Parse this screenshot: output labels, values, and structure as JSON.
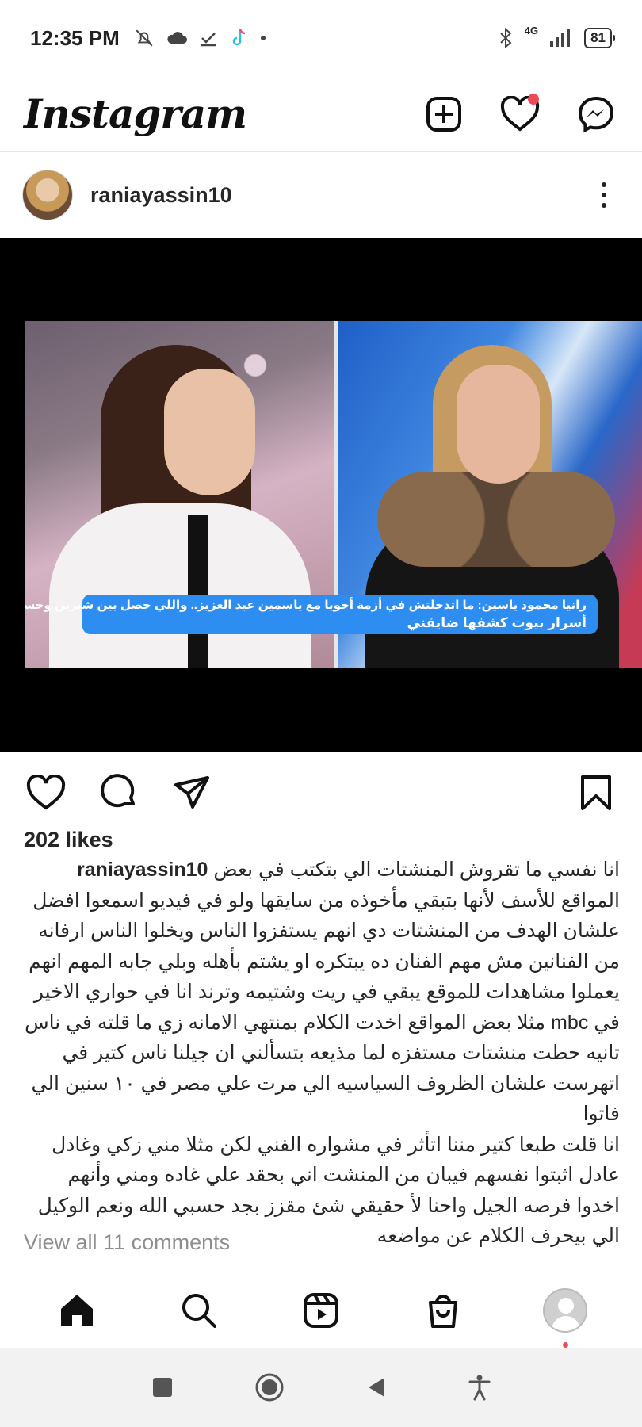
{
  "status_bar": {
    "time": "12:35 PM",
    "network": "4G",
    "battery": "81",
    "left_icons": [
      "mute-icon",
      "cloud-icon",
      "download-icon",
      "tiktok-icon",
      "dot-icon"
    ],
    "right_icons": [
      "bluetooth-icon",
      "signal-icon",
      "battery-icon"
    ]
  },
  "header": {
    "logo": "Instagram",
    "icons": [
      "new-post-icon",
      "heart-icon",
      "messenger-icon"
    ],
    "notification_color": "#ed4956"
  },
  "post": {
    "username": "raniayassin10",
    "more_icon": "more-vertical-icon",
    "media": {
      "lower_third_line1": "رانيا محمود ياسين: ما اتدخلتش في أزمة أخويا مع ياسمين عبد العزيز.. واللي حصل بين شيرين وحسام حبيب",
      "lower_third_line2": "أسرار بيوت كشفها ضايقني",
      "accent_color": "#2d8df0"
    },
    "actions": [
      "like-icon",
      "comment-icon",
      "share-icon",
      "bookmark-icon"
    ],
    "likes": "202 likes",
    "caption_user": "raniayassin10",
    "caption_lines": [
      "انا نفسي ما تقروش المنشتات الي بتكتب في  بعض",
      "المواقع للأسف لأنها  بتبقي مأخوذه من سايقها  ولو في فيديو اسمعوا  افضل",
      "علشان الهدف من المنشتات دي انهم  يستفزوا  الناس  ويخلوا الناس ارفانه",
      "من الفنانين مش مهم الفنان ده يبتكره او يشتم بأهله وبلي جابه  المهم انهم",
      "يعملوا مشاهدات للموقع يبقي في ريت وشتيمه وترند انا في حواري الاخير",
      "في mbc مثلا بعض المواقع اخدت الكلام بمنتهي الامانه زي ما قلته في ناس",
      "تانيه  حطت منشتات مستفزه لما مذيعه بتسألني ان جيلنا ناس كتير في",
      "اتهرست علشان الظروف السياسيه  الي مرت علي مصر في ١٠ سنين الي فاتوا",
      "انا قلت طبعا كتير مننا اتأثر في مشواره الفني لكن مثلا مني زكي وغادل",
      "عادل اثبتوا  نفسهم  فيبان من المنشت اني بحقد علي غاده ومني وأنهم",
      "اخدوا فرصه الجيل واحنا لأ حقيقي شئ مقزز بجد  حسبي الله ونعم الوكيل",
      "الي بيحرف الكلام عن مواضعه"
    ],
    "view_comments": "View all 11 comments"
  },
  "bottom_nav": {
    "items": [
      "home-icon",
      "search-icon",
      "reels-icon",
      "shop-icon",
      "profile-avatar"
    ]
  },
  "android_nav": {
    "items": [
      "recents-button",
      "home-button",
      "back-button",
      "accessibility-button"
    ]
  }
}
